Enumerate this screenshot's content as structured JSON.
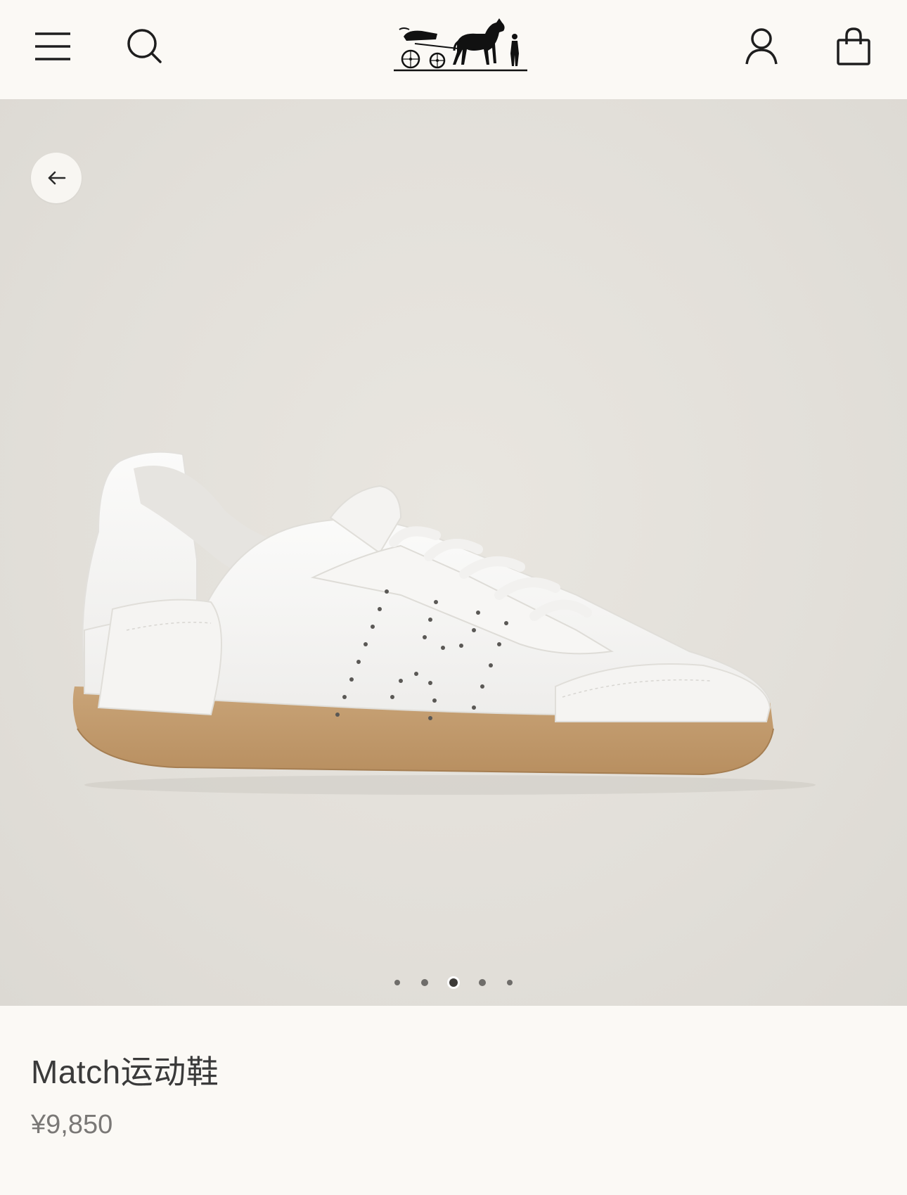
{
  "header": {
    "menu_icon": "menu-icon",
    "search_icon": "search-icon",
    "logo_icon": "hermes-carriage-logo",
    "account_icon": "account-icon",
    "bag_icon": "shopping-bag-icon"
  },
  "gallery": {
    "back_icon": "arrow-left-icon",
    "image": "white-leather-sneaker-side-view",
    "slide_count": 5,
    "active_slide": 3
  },
  "product": {
    "name": "Match运动鞋",
    "price": "¥9,850"
  },
  "colors": {
    "background": "#fbf9f5",
    "gallery_bg": "#e2dfd9",
    "text_primary": "#3a3a3a",
    "text_secondary": "#7a7876"
  }
}
